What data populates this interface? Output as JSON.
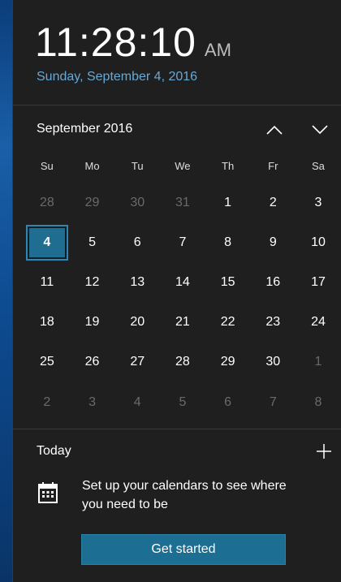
{
  "clock": {
    "time": "11:28:10",
    "ampm": "AM",
    "date": "Sunday, September 4, 2016"
  },
  "calendar": {
    "month_label": "September 2016",
    "nav_up_icon": "chevron-up-icon",
    "nav_down_icon": "chevron-down-icon",
    "weekdays": [
      "Su",
      "Mo",
      "Tu",
      "We",
      "Th",
      "Fr",
      "Sa"
    ],
    "days": [
      {
        "label": "28",
        "current": false
      },
      {
        "label": "29",
        "current": false
      },
      {
        "label": "30",
        "current": false
      },
      {
        "label": "31",
        "current": false
      },
      {
        "label": "1",
        "current": true
      },
      {
        "label": "2",
        "current": true
      },
      {
        "label": "3",
        "current": true
      },
      {
        "label": "4",
        "current": true,
        "today": true
      },
      {
        "label": "5",
        "current": true
      },
      {
        "label": "6",
        "current": true
      },
      {
        "label": "7",
        "current": true
      },
      {
        "label": "8",
        "current": true
      },
      {
        "label": "9",
        "current": true
      },
      {
        "label": "10",
        "current": true
      },
      {
        "label": "11",
        "current": true
      },
      {
        "label": "12",
        "current": true
      },
      {
        "label": "13",
        "current": true
      },
      {
        "label": "14",
        "current": true
      },
      {
        "label": "15",
        "current": true
      },
      {
        "label": "16",
        "current": true
      },
      {
        "label": "17",
        "current": true
      },
      {
        "label": "18",
        "current": true
      },
      {
        "label": "19",
        "current": true
      },
      {
        "label": "20",
        "current": true
      },
      {
        "label": "21",
        "current": true
      },
      {
        "label": "22",
        "current": true
      },
      {
        "label": "23",
        "current": true
      },
      {
        "label": "24",
        "current": true
      },
      {
        "label": "25",
        "current": true
      },
      {
        "label": "26",
        "current": true
      },
      {
        "label": "27",
        "current": true
      },
      {
        "label": "28",
        "current": true
      },
      {
        "label": "29",
        "current": true
      },
      {
        "label": "30",
        "current": true
      },
      {
        "label": "1",
        "current": false
      },
      {
        "label": "2",
        "current": false
      },
      {
        "label": "3",
        "current": false
      },
      {
        "label": "4",
        "current": false
      },
      {
        "label": "5",
        "current": false
      },
      {
        "label": "6",
        "current": false
      },
      {
        "label": "7",
        "current": false
      },
      {
        "label": "8",
        "current": false
      }
    ]
  },
  "agenda": {
    "title": "Today",
    "add_icon": "plus-icon",
    "calendar_icon": "calendar-icon",
    "message": "Set up your calendars to see where you need to be",
    "button_label": "Get started"
  },
  "colors": {
    "accent": "#1c6f93",
    "date_text": "#66a9d6",
    "background": "#1f1f1f"
  }
}
